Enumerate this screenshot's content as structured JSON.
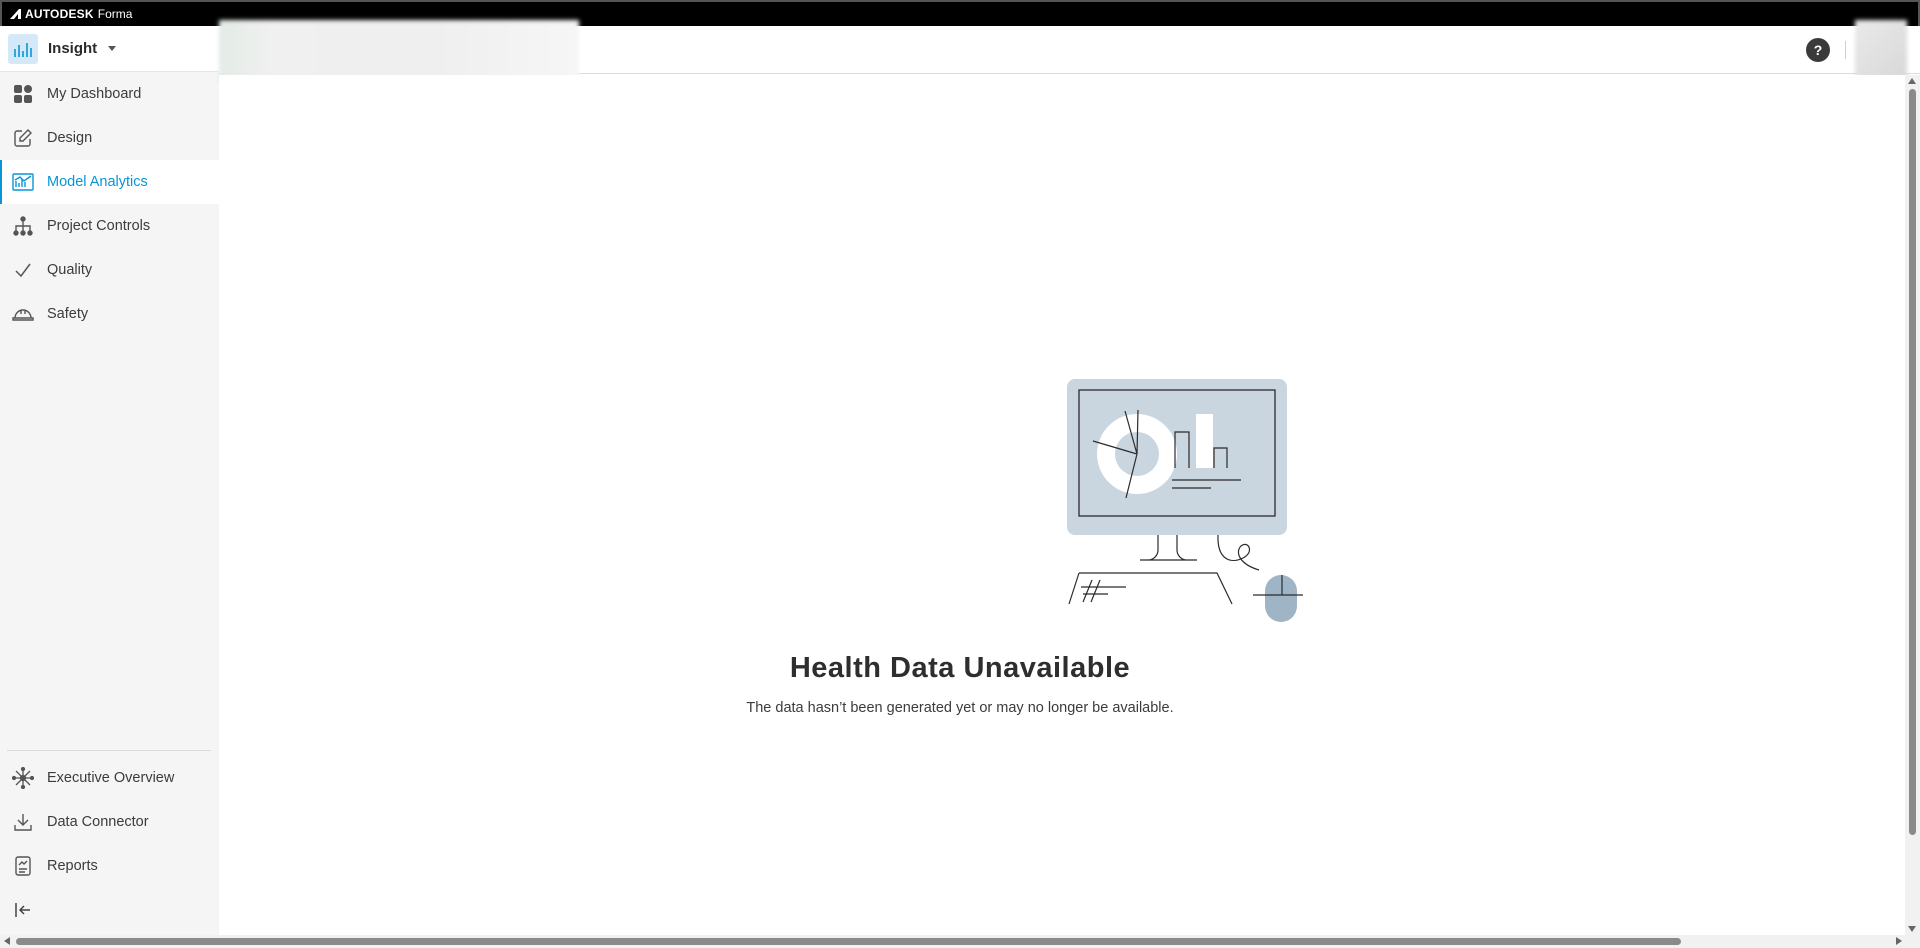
{
  "brand": {
    "name": "AUTODESK",
    "product": "Forma"
  },
  "module": {
    "name": "Insight"
  },
  "nav": {
    "top": [
      {
        "label": "My Dashboard",
        "icon": "dashboard-grid-icon"
      },
      {
        "label": "Design",
        "icon": "edit-pencil-icon"
      },
      {
        "label": "Model Analytics",
        "icon": "model-analytics-icon",
        "active": true
      },
      {
        "label": "Project Controls",
        "icon": "hierarchy-icon"
      },
      {
        "label": "Quality",
        "icon": "checkmark-icon"
      },
      {
        "label": "Safety",
        "icon": "hard-hat-icon"
      }
    ],
    "bottom": [
      {
        "label": "Executive Overview",
        "icon": "network-icon"
      },
      {
        "label": "Data Connector",
        "icon": "download-icon"
      },
      {
        "label": "Reports",
        "icon": "report-icon"
      }
    ]
  },
  "header": {
    "help": "?"
  },
  "empty_state": {
    "title": "Health Data Unavailable",
    "message": "The data hasn’t been generated yet or may no longer be available."
  },
  "colors": {
    "accent": "#0696d7",
    "illustration": "#c9d6e0"
  }
}
